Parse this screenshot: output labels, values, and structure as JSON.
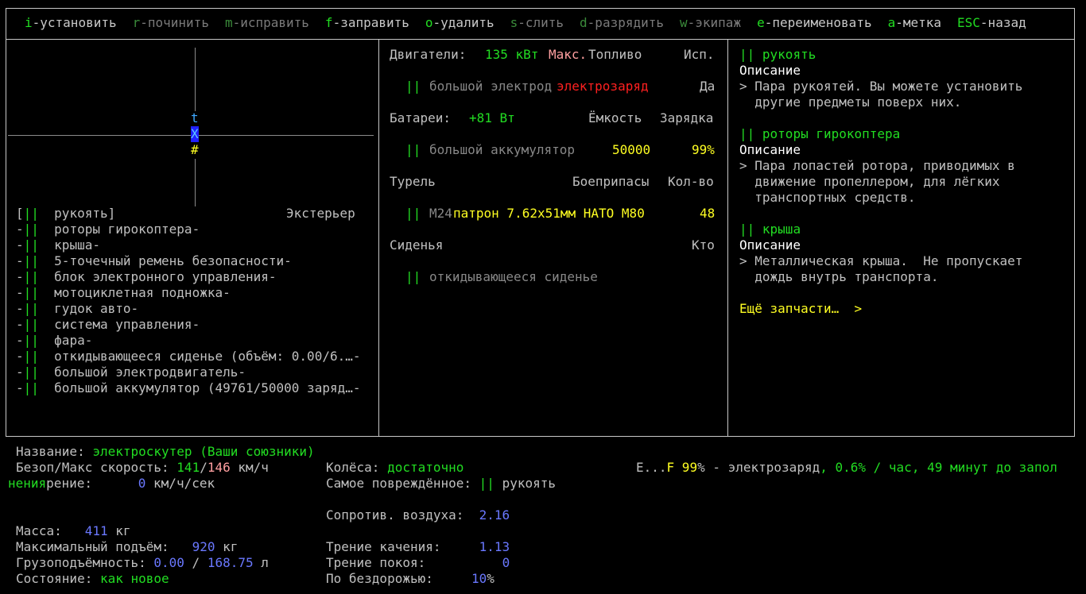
{
  "menu": [
    {
      "key": "i",
      "label": "-установить",
      "enabled": true
    },
    {
      "key": "r",
      "label": "-починить",
      "enabled": false
    },
    {
      "key": "m",
      "label": "-исправить",
      "enabled": false
    },
    {
      "key": "f",
      "label": "-заправить",
      "enabled": true
    },
    {
      "key": "o",
      "label": "-удалить",
      "enabled": true
    },
    {
      "key": "s",
      "label": "-слить",
      "enabled": false
    },
    {
      "key": "d",
      "label": "-разрядить",
      "enabled": false
    },
    {
      "key": "w",
      "label": "-экипаж",
      "enabled": false
    },
    {
      "key": "e",
      "label": "-переименовать",
      "enabled": true
    },
    {
      "key": "a",
      "label": "-метка",
      "enabled": true
    },
    {
      "key": "ESC",
      "label": "-назад",
      "enabled": true
    }
  ],
  "map": {
    "t": "t",
    "x": "X",
    "hash": "#"
  },
  "parts": {
    "header_right": "Экстерьер",
    "items": [
      {
        "prefix": "[",
        "name": "рукоять]",
        "suffix": ""
      },
      {
        "prefix": "-",
        "name": "роторы гирокоптера-",
        "suffix": ""
      },
      {
        "prefix": "-",
        "name": "крыша-",
        "suffix": ""
      },
      {
        "prefix": "-",
        "name": "5-точечный ремень безопасности-",
        "suffix": ""
      },
      {
        "prefix": "-",
        "name": "блок электронного управления-",
        "suffix": ""
      },
      {
        "prefix": "-",
        "name": "мотоциклетная подножка-",
        "suffix": ""
      },
      {
        "prefix": "-",
        "name": "гудок авто-",
        "suffix": ""
      },
      {
        "prefix": "-",
        "name": "система управления-",
        "suffix": ""
      },
      {
        "prefix": "-",
        "name": "фара-",
        "suffix": ""
      },
      {
        "prefix": "-",
        "name": "откидывающееся сиденье (объём: 0.00/6.…-",
        "suffix": ""
      },
      {
        "prefix": "-",
        "name": "большой электродвигатель-",
        "suffix": ""
      },
      {
        "prefix": "-",
        "name": "большой аккумулятор (49761/50000 заряд…-",
        "suffix": ""
      }
    ],
    "bars": "||"
  },
  "middle": {
    "engines": {
      "label": "Двигатели:",
      "power": "135 кВт",
      "max": "Макс.",
      "fuel": "Топливо",
      "use": "Исп."
    },
    "engine_row": {
      "name": "большой электрод",
      "fuel": "электрозаряд",
      "active": "Да"
    },
    "batteries": {
      "label": "Батареи:",
      "power": "+81 Вт",
      "capacity": "Ёмкость",
      "charge": "Зарядка"
    },
    "battery_row": {
      "name": "большой аккумулятор",
      "capacity": "50000",
      "charge": "99%"
    },
    "turret": {
      "label": "Турель",
      "ammo": "Боеприпасы",
      "count": "Кол-во"
    },
    "turret_row": {
      "name": "M24",
      "ammo": "патрон 7.62x51мм НАТО М80",
      "count": "48"
    },
    "seats": {
      "label": "Сиденья",
      "who": "Кто"
    },
    "seat_row": {
      "name": "откидывающееся сиденье"
    }
  },
  "descriptions": [
    {
      "title": "рукоять",
      "heading": "Описание",
      "lines": [
        "> Пара рукоятей. Вы можете установить",
        "  другие предметы поверх них."
      ]
    },
    {
      "title": "роторы гирокоптера",
      "heading": "Описание",
      "lines": [
        "> Пара лопастей ротора, приводимых в",
        "  движение пропеллером, для лёгких",
        "  транспортных средств."
      ]
    },
    {
      "title": "крыша",
      "heading": "Описание",
      "lines": [
        "> Металлическая крыша.  Не пропускает",
        "  дождь внутрь транспорта."
      ]
    }
  ],
  "more_parts": "Ещё запчасти…  >",
  "bottom": {
    "name_label": "Название: ",
    "name_value": "электроскутер (Ваши союзники)",
    "speed_label": "Безоп/Макс скорость: ",
    "speed_safe": "141",
    "speed_sep": "/",
    "speed_max": "146",
    "speed_unit": " км/ч",
    "accel_prefix": "нения",
    "accel_label": "рение:      ",
    "accel_value": "0",
    "accel_unit": " км/ч/сек",
    "mass_label": "Масса:   ",
    "mass_value": "411",
    "mass_unit": " кг",
    "lift_label": "Максимальный подъём:   ",
    "lift_value": "920",
    "lift_unit": " кг",
    "cargo_label": "Грузоподъёмность: ",
    "cargo_used": "0.00",
    "cargo_sep": " / ",
    "cargo_max": "168.75",
    "cargo_unit": " л",
    "status_label": "Состояние: ",
    "status_value": "как новое",
    "wheels_label": "Колёса: ",
    "wheels_value": "достаточно",
    "damaged_label": "Самое повреждённое: ",
    "damaged_value": "рукоять",
    "air_label": "Сопротив. воздуха:  ",
    "air_value": "2.16",
    "roll_label": "Трение качения:     ",
    "roll_value": "1.13",
    "static_label": "Трение покоя:          ",
    "static_value": "0",
    "offroad_label": "По бездорожью:     ",
    "offroad_value": "10",
    "offroad_unit": "%",
    "fuel_e": "E...",
    "fuel_f": "F",
    "fuel_pct": " 99",
    "fuel_pct_unit": "%",
    "fuel_name": " - электрозаряд",
    "fuel_rate": ", 0.6% / час, 49 минут до запол"
  }
}
